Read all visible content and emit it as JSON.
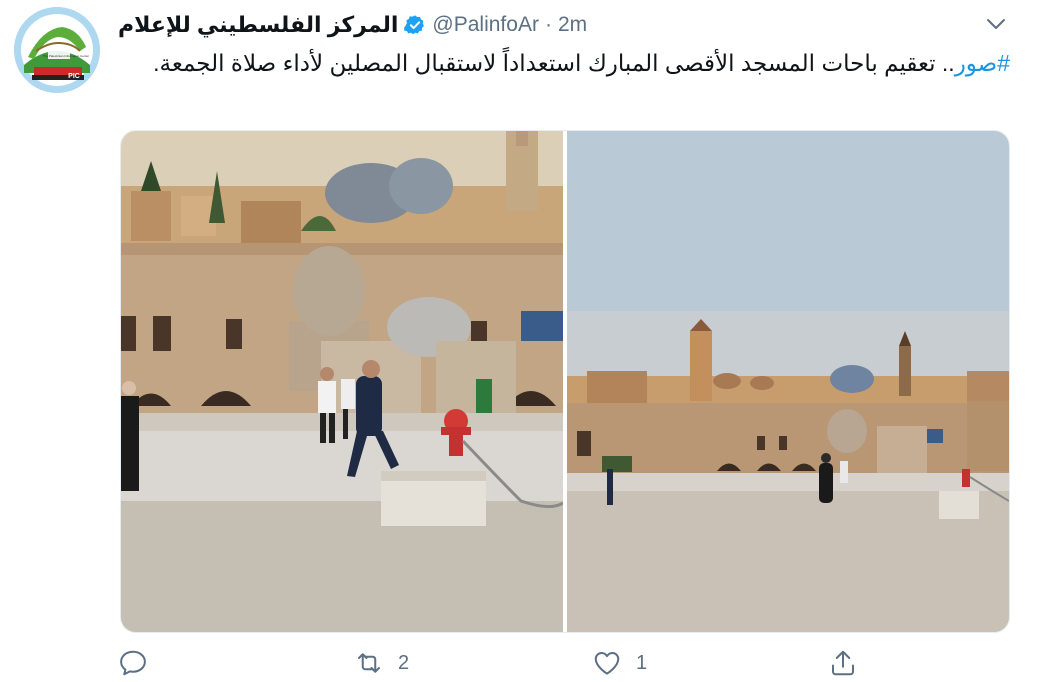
{
  "author": {
    "display_name": "المركز الفلسطيني للإعلام",
    "handle": "@PalinfoAr",
    "separator": "·",
    "time": "2m",
    "verified": true,
    "avatar_logo_text": "The Palestinian Information Center",
    "avatar_logo_abbr": "PIC"
  },
  "tweet": {
    "hashtag": "#صور",
    "text": ".. تعقيم باحات المسجد الأقصى المبارك استعداداً لاستقبال المصلين لأداء صلاة الجمعة."
  },
  "media": {
    "photos": [
      {
        "subject": "worker disinfecting courtyard with hose near fire hydrant"
      },
      {
        "subject": "wide view of courtyard at sunset with old city skyline"
      }
    ]
  },
  "actions": {
    "reply_count": "",
    "retweet_count": "2",
    "like_count": "1"
  },
  "colors": {
    "accent": "#1b95e0",
    "verified": "#1da1f2",
    "secondary_text": "#5b7083",
    "primary_text": "#0f1419"
  }
}
